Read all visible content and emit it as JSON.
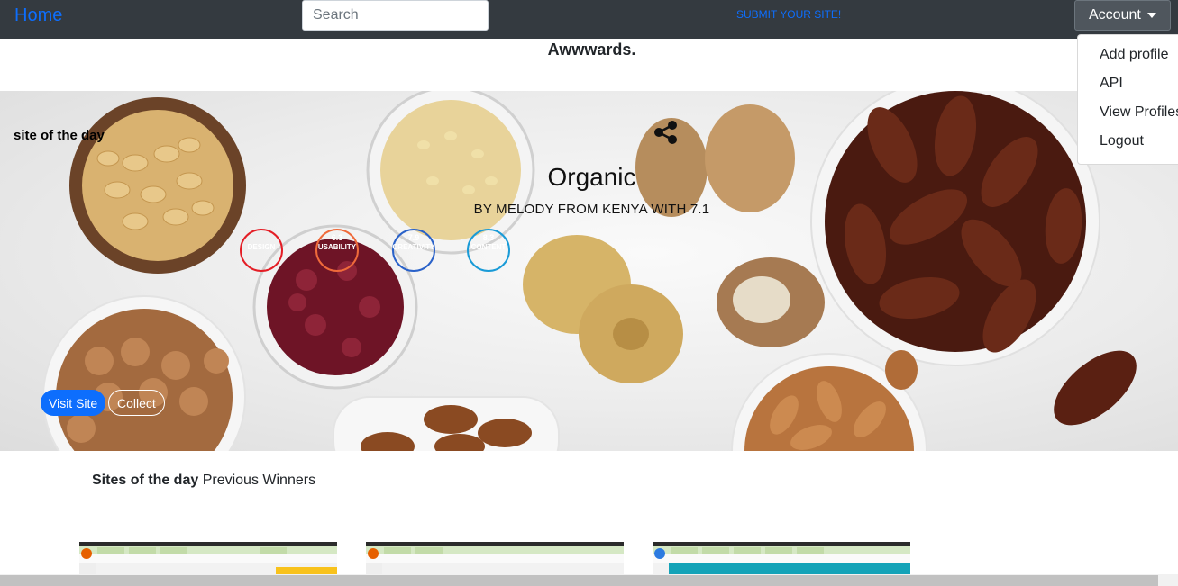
{
  "navbar": {
    "brand": "Home",
    "search_placeholder": "Search",
    "submit_link": "SUBMIT YOUR SITE!",
    "account_label": "Account"
  },
  "account_menu": {
    "items": [
      "Add profile",
      "API",
      "View Profiles",
      "Logout"
    ]
  },
  "page_title": "Awwwards.",
  "hero": {
    "eyebrow": "site of the day",
    "site_name": "Organic",
    "byline": "BY MELODY FROM KENYA WITH 7.1",
    "scores": [
      {
        "label": "DESIGN",
        "value": "",
        "color": "#e41e26"
      },
      {
        "label": "USABILITY",
        "value": "6.3",
        "color": "#ef6a3a"
      },
      {
        "label": "CREATIVITY",
        "value": "7.9",
        "color": "#2a62c9"
      },
      {
        "label": "CONTENT",
        "value": "8.3",
        "color": "#1a9bd7"
      }
    ],
    "visit_label": "Visit Site",
    "collect_label": "Collect"
  },
  "section": {
    "title_bold": "Sites of the day",
    "title_rest": "Previous Winners"
  },
  "colors": {
    "navbar_bg": "#343a40",
    "brand": "#0d6efd",
    "primary_button": "#0d6efd"
  }
}
